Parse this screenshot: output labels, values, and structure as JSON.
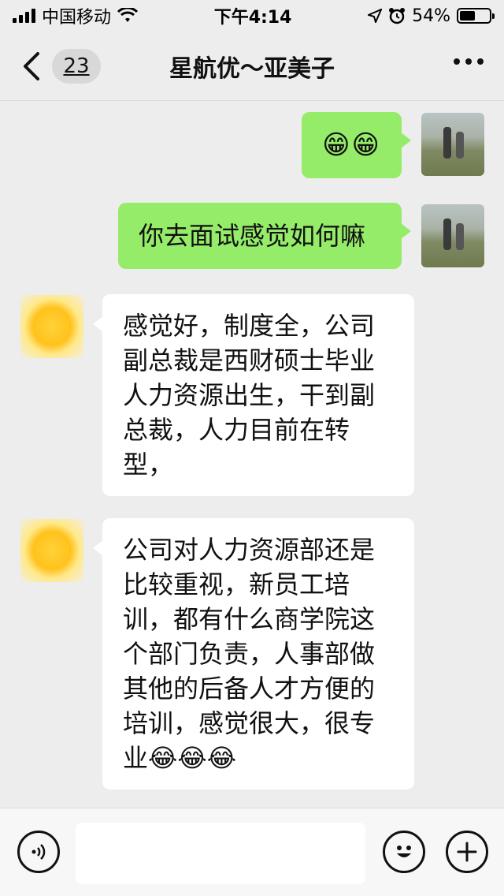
{
  "status_bar": {
    "carrier": "中国移动",
    "time": "下午4:14",
    "battery_percent": "54%",
    "battery_level": 0.54
  },
  "nav": {
    "unread_count": "23",
    "title": "星航优～亚美子",
    "back_icon": "chevron-left-icon",
    "more_icon": "more-dots-icon"
  },
  "messages": [
    {
      "side": "out",
      "text": "😁😁"
    },
    {
      "side": "out",
      "text": "你去面试感觉如何嘛"
    },
    {
      "side": "in",
      "text": "感觉好，制度全，公司副总裁是西财硕士毕业人力资源出生，干到副总裁，人力目前在转型，"
    },
    {
      "side": "in",
      "text": "公司对人力资源部还是比较重视，新员工培训，都有什么商学院这个部门负责，人事部做其他的后备人才方便的培训，感觉很大，很专业😂😂😂"
    }
  ],
  "input_bar": {
    "voice_icon": "voice-icon",
    "emoji_icon": "smile-icon",
    "plus_icon": "plus-icon",
    "draft": ""
  },
  "colors": {
    "outgoing_bubble": "#95ec69",
    "incoming_bubble": "#ffffff",
    "background": "#ededed"
  }
}
